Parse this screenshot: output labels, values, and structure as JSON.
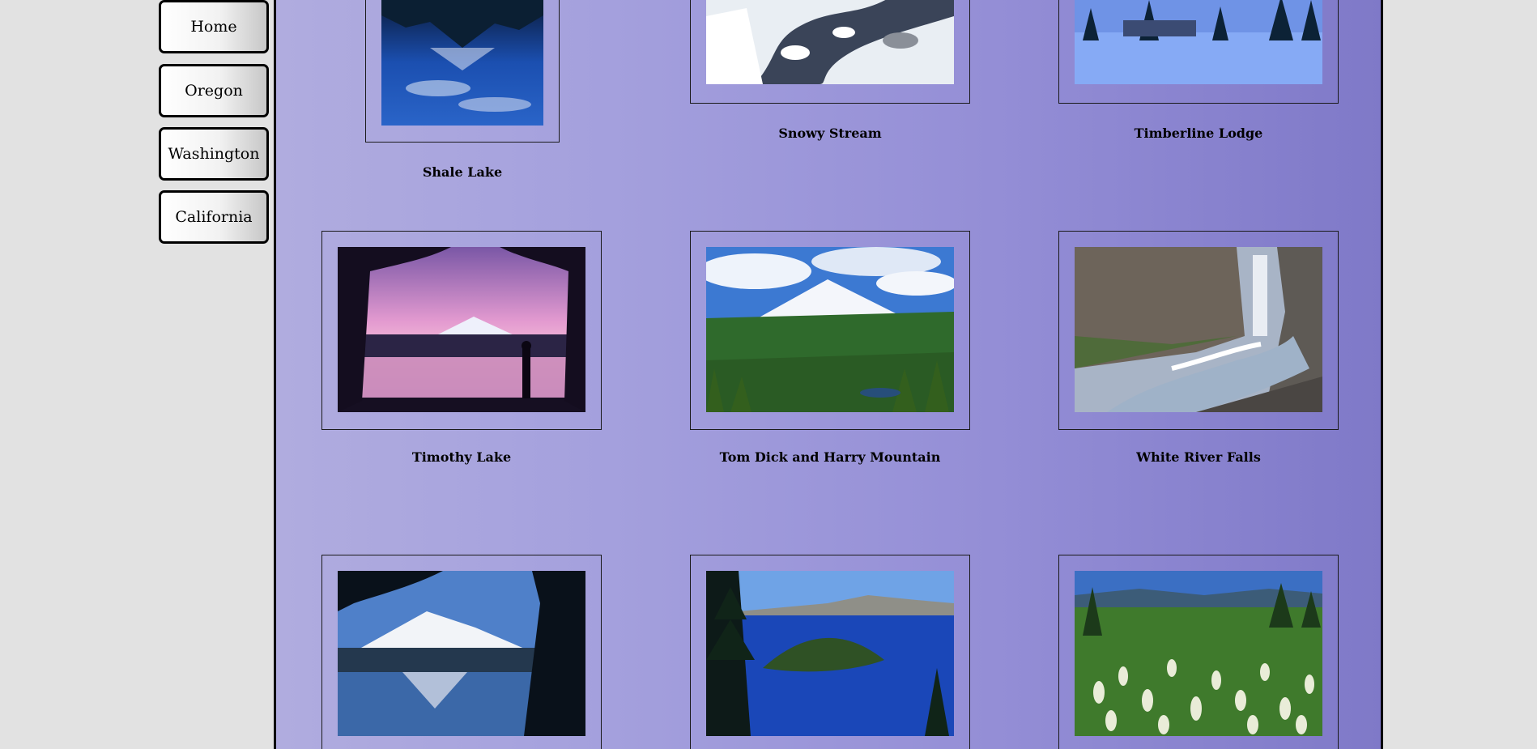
{
  "nav": {
    "items": [
      {
        "label": "Home"
      },
      {
        "label": "Oregon"
      },
      {
        "label": "Washington"
      },
      {
        "label": "California"
      }
    ]
  },
  "gallery": {
    "row1": [
      {
        "caption": "Shale Lake"
      },
      {
        "caption": "Snowy Stream"
      },
      {
        "caption": "Timberline Lodge"
      }
    ],
    "row2": [
      {
        "caption": "Timothy Lake"
      },
      {
        "caption": "Tom Dick and Harry Mountain"
      },
      {
        "caption": "White River Falls"
      }
    ],
    "row3": [
      {
        "caption": ""
      },
      {
        "caption": ""
      },
      {
        "caption": ""
      }
    ]
  },
  "colors": {
    "page_background": "#e2e2e2",
    "panel_gradient_start": "#b0acdf",
    "panel_gradient_end": "#7f79c8",
    "border": "#000000"
  }
}
